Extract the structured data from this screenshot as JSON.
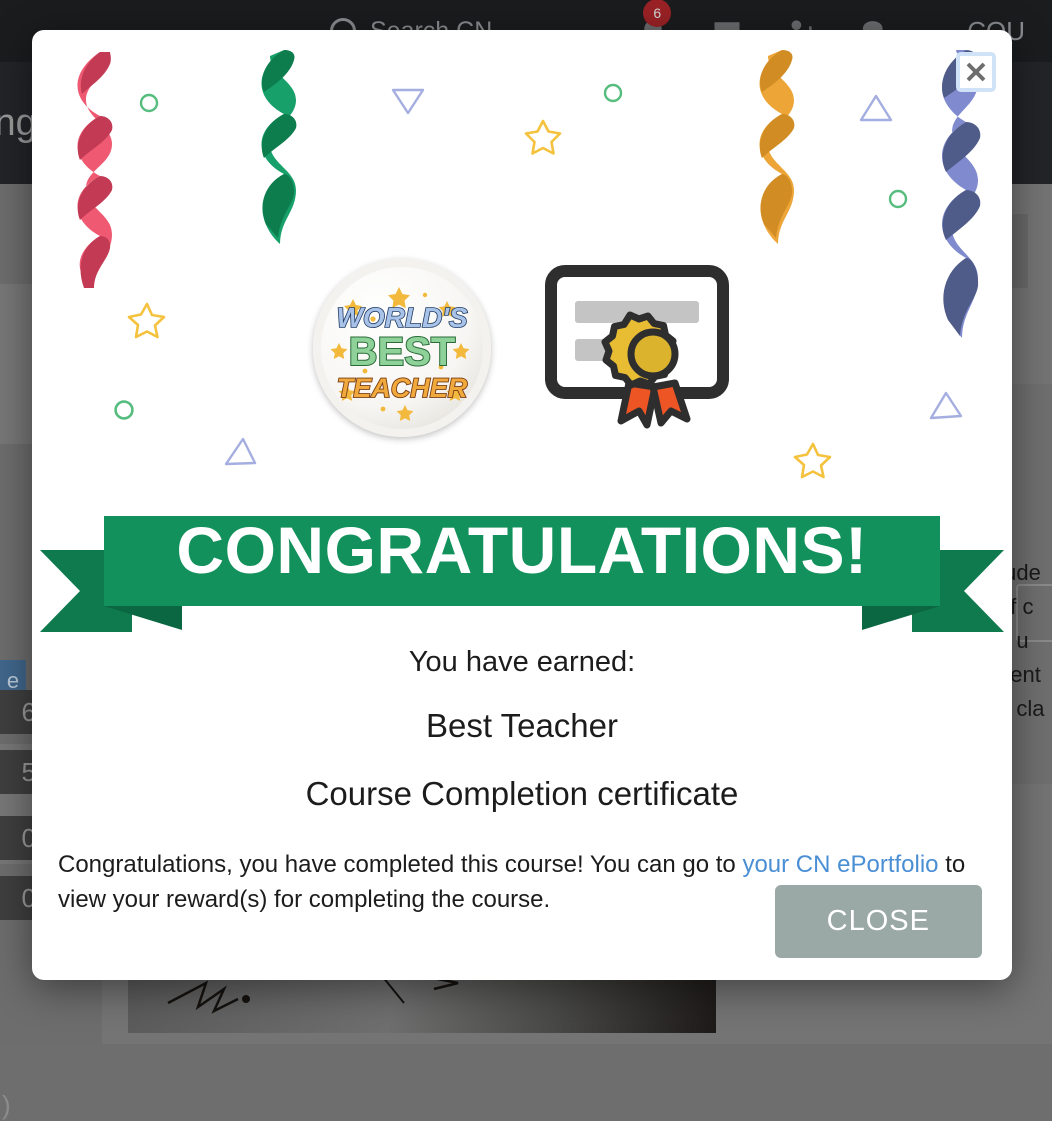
{
  "background": {
    "topbar": {
      "search_placeholder": "Search CN",
      "notifications_badge": "6",
      "icons": [
        {
          "name": "bell-icon"
        },
        {
          "name": "envelope-icon"
        },
        {
          "name": "add-person-icon"
        },
        {
          "name": "chat-icon"
        }
      ],
      "right_label": "COU"
    },
    "page_title_fragment": "ing",
    "sidebar_counts": [
      "6",
      "5",
      "0",
      "0"
    ],
    "sidebar_button_fragment": "e",
    "sidebar_paren_fragment": ")",
    "right_text_lines": [
      "tude",
      "of c",
      "n u",
      "dent",
      "n cla"
    ]
  },
  "modal": {
    "close_icon_label": "close-icon",
    "banner_text": "CONGRATULATIONS!",
    "earned_label": "You have earned:",
    "reward_name": "Best Teacher",
    "reward_certificate": "Course Completion certificate",
    "description_before": "Congratulations, you have completed this course! You can go to ",
    "description_link": "your CN ePortfolio",
    "description_after": " to view your reward(s) for completing the course.",
    "close_button_label": "CLOSE",
    "badge": {
      "line1": "WORLD'S",
      "line2": "BEST",
      "line3": "TEACHER"
    },
    "colors": {
      "banner_green": "#13915c",
      "banner_green_dark": "#0f7a4d",
      "close_button": "#9aa9a6",
      "link_blue": "#4a8fd4",
      "streamer_red": "#d94b62",
      "streamer_green": "#13915c",
      "streamer_orange": "#e8a32c",
      "streamer_blue": "#7b87cb",
      "confetti_gold": "#f5c23e",
      "confetti_mint": "#57bd7e",
      "confetti_periwinkle": "#a5aee0",
      "cert_gold": "#e8bd34",
      "cert_orange": "#ee5524",
      "cert_dark": "#2e2e2e"
    }
  }
}
